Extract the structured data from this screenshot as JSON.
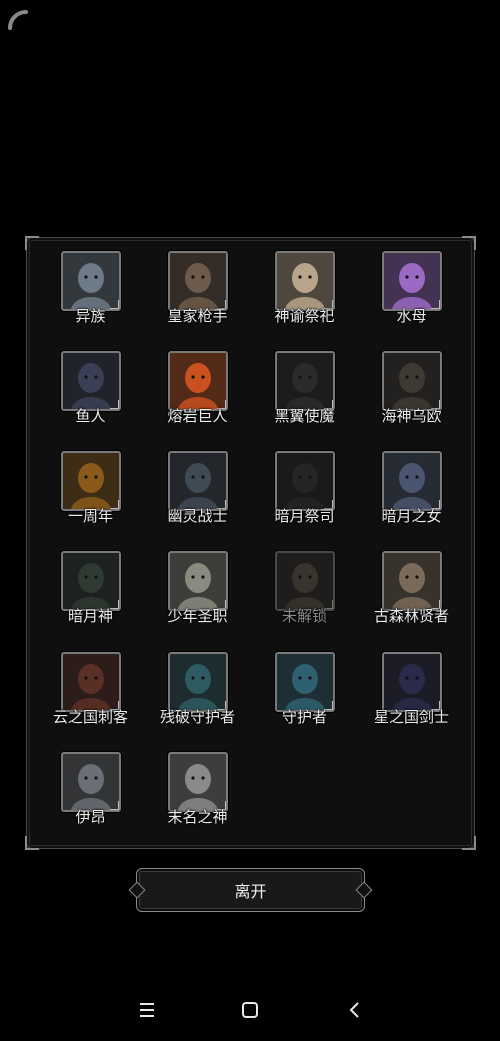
{
  "dialog": {
    "heroes": [
      {
        "name": "异族",
        "locked": false,
        "icon": "alien-elder-portrait",
        "color": "#6d7b88"
      },
      {
        "name": "皇家枪手",
        "locked": false,
        "icon": "royal-gunner-portrait",
        "color": "#6e5a4a"
      },
      {
        "name": "神谕祭祀",
        "locked": false,
        "icon": "oracle-priest-portrait",
        "color": "#b9a58a"
      },
      {
        "name": "水母",
        "locked": false,
        "icon": "jellyfish-portrait",
        "color": "#9a6ac2"
      },
      {
        "name": "鱼人",
        "locked": false,
        "icon": "fishman-portrait",
        "color": "#3a3f55"
      },
      {
        "name": "熔岩巨人",
        "locked": false,
        "icon": "lava-giant-portrait",
        "color": "#c9501f"
      },
      {
        "name": "黑翼使魔",
        "locked": false,
        "icon": "black-wing-familiar-portrait",
        "color": "#2b2b2b"
      },
      {
        "name": "海神乌欧",
        "locked": false,
        "icon": "sea-god-portrait",
        "color": "#3d3a33"
      },
      {
        "name": "一周年",
        "locked": false,
        "icon": "anniversary-portrait",
        "color": "#8a5a1a"
      },
      {
        "name": "幽灵战士",
        "locked": false,
        "icon": "ghost-warrior-portrait",
        "color": "#3f4a55"
      },
      {
        "name": "暗月祭司",
        "locked": false,
        "icon": "dark-moon-priest-portrait",
        "color": "#252525"
      },
      {
        "name": "暗月之女",
        "locked": false,
        "icon": "dark-moon-maiden-portrait",
        "color": "#4a5670"
      },
      {
        "name": "暗月神",
        "locked": false,
        "icon": "dark-moon-god-portrait",
        "color": "#2f3a33"
      },
      {
        "name": "少年圣职",
        "locked": false,
        "icon": "young-cleric-portrait",
        "color": "#8b8a80"
      },
      {
        "name": "未解锁",
        "locked": true,
        "icon": "locked-sage-portrait",
        "color": "#5a5247"
      },
      {
        "name": "古森林贤者",
        "locked": false,
        "icon": "forest-sage-portrait",
        "color": "#7a6a58"
      },
      {
        "name": "云之国刺客",
        "locked": false,
        "icon": "cloud-assassin-portrait",
        "color": "#5a2f25"
      },
      {
        "name": "残破守护者",
        "locked": false,
        "icon": "broken-guardian-portrait",
        "color": "#2e5a62"
      },
      {
        "name": "守护者",
        "locked": false,
        "icon": "guardian-portrait",
        "color": "#2f6070"
      },
      {
        "name": "星之国剑士",
        "locked": false,
        "icon": "star-swordsman-portrait",
        "color": "#2a2a4a"
      },
      {
        "name": "伊昂",
        "locked": false,
        "icon": "ion-portrait",
        "color": "#6a6f75"
      },
      {
        "name": "末名之神",
        "locked": false,
        "icon": "nameless-god-portrait",
        "color": "#8a8a8a"
      }
    ],
    "leave_label": "离开"
  },
  "system_nav": {
    "icons": [
      "menu-icon",
      "home-icon",
      "back-icon"
    ]
  }
}
